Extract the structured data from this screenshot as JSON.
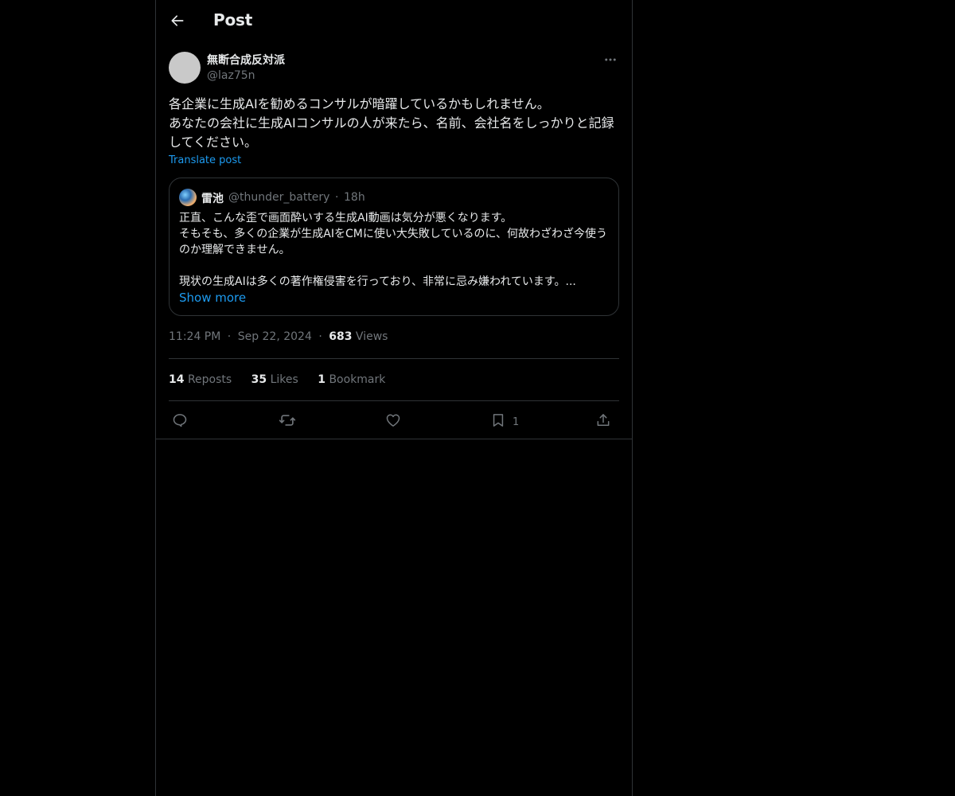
{
  "header": {
    "title": "Post",
    "back_icon": "arrow-left-icon"
  },
  "author": {
    "display_name": "無断合成反対派",
    "handle": "@laz75n",
    "more_icon": "more-horizontal-icon"
  },
  "post": {
    "text": "各企業に生成AIを勧めるコンサルが暗躍しているかもしれません。\nあなたの会社に生成AIコンサルの人が来たら、名前、会社名をしっかりと記録してください。",
    "translate_label": "Translate post"
  },
  "quote": {
    "name": "雷池",
    "handle": "@thunder_battery",
    "separator": "·",
    "time": "18h",
    "text": "正直、こんな歪で画面酔いする生成AI動画は気分が悪くなります。\nそもそも、多くの企業が生成AIをCMに使い大失敗しているのに、何故わざわざ今使うのか理解できません。\n\n現状の生成AIは多くの著作権侵害を行っており、非常に忌み嫌われています。...",
    "show_more_label": "Show more"
  },
  "meta": {
    "time": "11:24 PM",
    "sep1": "·",
    "date": "Sep 22, 2024",
    "sep2": "·",
    "views_count": "683",
    "views_label": "Views"
  },
  "stats": {
    "reposts_count": "14",
    "reposts_label": "Reposts",
    "likes_count": "35",
    "likes_label": "Likes",
    "bookmarks_count": "1",
    "bookmarks_label": "Bookmark"
  },
  "actions": {
    "reply_icon": "reply-icon",
    "repost_icon": "repost-icon",
    "like_icon": "heart-icon",
    "bookmark_icon": "bookmark-icon",
    "bookmark_count": "1",
    "share_icon": "share-icon"
  },
  "colors": {
    "background": "#000000",
    "text": "#e7e9ea",
    "secondary": "#71767b",
    "accent": "#1d9bf0",
    "border": "#2f3336"
  }
}
